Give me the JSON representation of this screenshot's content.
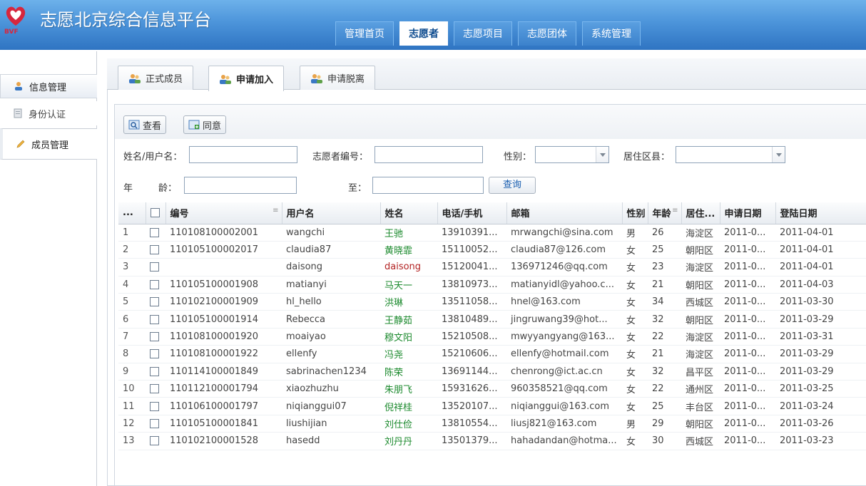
{
  "app": {
    "title": "志愿北京综合信息平台",
    "logo_text": "BVF",
    "brand_color": "#d7263d"
  },
  "topnav": [
    {
      "label": "管理首页",
      "active": false
    },
    {
      "label": "志愿者",
      "active": true
    },
    {
      "label": "志愿项目",
      "active": false
    },
    {
      "label": "志愿团体",
      "active": false
    },
    {
      "label": "系统管理",
      "active": false
    }
  ],
  "sidebar": {
    "items": [
      {
        "label": "信息管理",
        "icon": "user-icon"
      },
      {
        "label": "身份认证",
        "icon": "id-card-icon"
      },
      {
        "label": "成员管理",
        "icon": "pencil-icon"
      }
    ]
  },
  "tabs": [
    {
      "label": "正式成员",
      "icon": "users-icon"
    },
    {
      "label": "申请加入",
      "icon": "users-add-icon"
    },
    {
      "label": "申请脱离",
      "icon": "users-remove-icon"
    }
  ],
  "toolbar": {
    "view_label": "查看",
    "approve_label": "同意"
  },
  "filters": {
    "name_label": "姓名/用户名：",
    "vol_id_label": "志愿者编号：",
    "gender_label": "性别：",
    "district_label": "居住区县：",
    "age_label_1": "年",
    "age_label_2": "龄：",
    "to_label": "至：",
    "query_label": "查询"
  },
  "table": {
    "columns": [
      "...",
      "",
      "编号",
      "用户名",
      "姓名",
      "电话/手机",
      "邮箱",
      "性别",
      "年龄",
      "居住...",
      "申请日期",
      "登陆日期"
    ],
    "rows": [
      [
        "1",
        "110108100002001",
        "wangchi",
        "王驰",
        "13910391...",
        "mrwangchi@sina.com",
        "男",
        "26",
        "海淀区",
        "2011-0...",
        "2011-04-01"
      ],
      [
        "2",
        "110105100002017",
        "claudia87",
        "黄晓霏",
        "15110052...",
        "claudia87@126.com",
        "女",
        "25",
        "朝阳区",
        "2011-0...",
        "2011-04-01"
      ],
      [
        "3",
        "",
        "daisong",
        "daisong",
        "15120041...",
        "136971246@qq.com",
        "女",
        "23",
        "海淀区",
        "2011-0...",
        "2011-04-01"
      ],
      [
        "4",
        "110105100001908",
        "matianyi",
        "马天一",
        "13810973...",
        "matianyidl@yahoo.c...",
        "女",
        "21",
        "朝阳区",
        "2011-0...",
        "2011-04-03"
      ],
      [
        "5",
        "110102100001909",
        "hl_hello",
        "洪琳",
        "13511058...",
        "hnel@163.com",
        "女",
        "34",
        "西城区",
        "2011-0...",
        "2011-03-30"
      ],
      [
        "6",
        "110105100001914",
        "Rebecca",
        "王静茹",
        "13810489...",
        "jingruwang39@hot...",
        "女",
        "32",
        "朝阳区",
        "2011-0...",
        "2011-03-29"
      ],
      [
        "7",
        "110108100001920",
        "moaiyao",
        "穆文阳",
        "15210508...",
        "mwyyangyang@163...",
        "女",
        "22",
        "海淀区",
        "2011-0...",
        "2011-03-31"
      ],
      [
        "8",
        "110108100001922",
        "ellenfy",
        "冯尧",
        "15210606...",
        "ellenfy@hotmail.com",
        "女",
        "21",
        "海淀区",
        "2011-0...",
        "2011-03-29"
      ],
      [
        "9",
        "110114100001849",
        "sabrinachen1234",
        "陈荣",
        "13691144...",
        "chenrong@ict.ac.cn",
        "女",
        "32",
        "昌平区",
        "2011-0...",
        "2011-03-29"
      ],
      [
        "10",
        "110112100001794",
        "xiaozhuzhu",
        "朱朋飞",
        "15931626...",
        "960358521@qq.com",
        "女",
        "22",
        "通州区",
        "2011-0...",
        "2011-03-25"
      ],
      [
        "11",
        "110106100001797",
        "niqianggui07",
        "倪祥桂",
        "13520107...",
        "niqianggui@163.com",
        "女",
        "25",
        "丰台区",
        "2011-0...",
        "2011-03-24"
      ],
      [
        "12",
        "110105100001841",
        "liushijian",
        "刘仕俭",
        "13810554...",
        "liusj821@163.com",
        "男",
        "29",
        "朝阳区",
        "2011-0...",
        "2011-03-26"
      ],
      [
        "13",
        "110102100001528",
        "hasedd",
        "刘丹丹",
        "13501379...",
        "hahadandan@hotma...",
        "女",
        "30",
        "西城区",
        "2011-0...",
        "2011-03-23"
      ]
    ]
  }
}
